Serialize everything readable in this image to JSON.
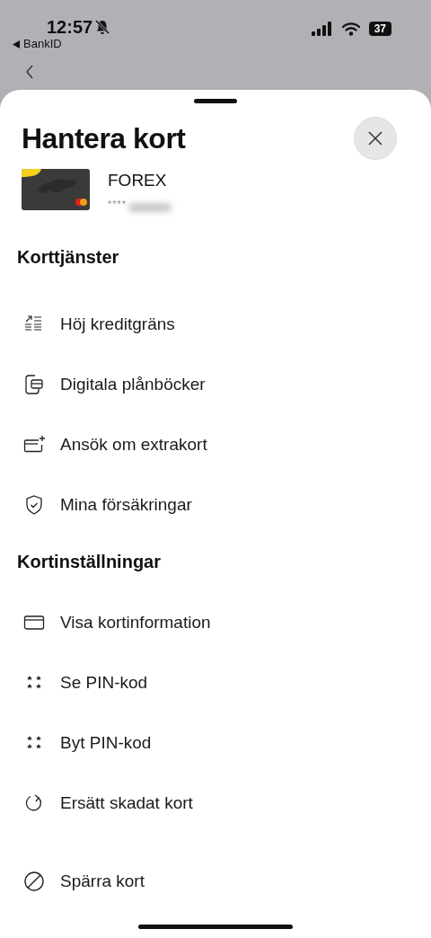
{
  "status_bar": {
    "time": "12:57",
    "back_app": "BankID",
    "battery": "37"
  },
  "sheet": {
    "title": "Hantera kort",
    "card": {
      "name": "FOREX",
      "number": "****"
    }
  },
  "sections": [
    {
      "title": "Korttjänster",
      "items": [
        {
          "label": "Höj kreditgräns",
          "kind": "limit"
        },
        {
          "label": "Digitala plånböcker",
          "kind": "wallet"
        },
        {
          "label": "Ansök om extrakort",
          "kind": "addcard"
        },
        {
          "label": "Mina försäkringar",
          "kind": "shield"
        }
      ]
    },
    {
      "title": "Kortinställningar",
      "items": [
        {
          "label": "Visa kortinformation",
          "kind": "card"
        },
        {
          "label": "Se PIN-kod",
          "kind": "pin"
        },
        {
          "label": "Byt PIN-kod",
          "kind": "pin"
        },
        {
          "label": "Ersätt skadat kort",
          "kind": "refresh"
        }
      ]
    },
    {
      "items": [
        {
          "label": "Spärra kort",
          "kind": "block"
        }
      ]
    }
  ]
}
